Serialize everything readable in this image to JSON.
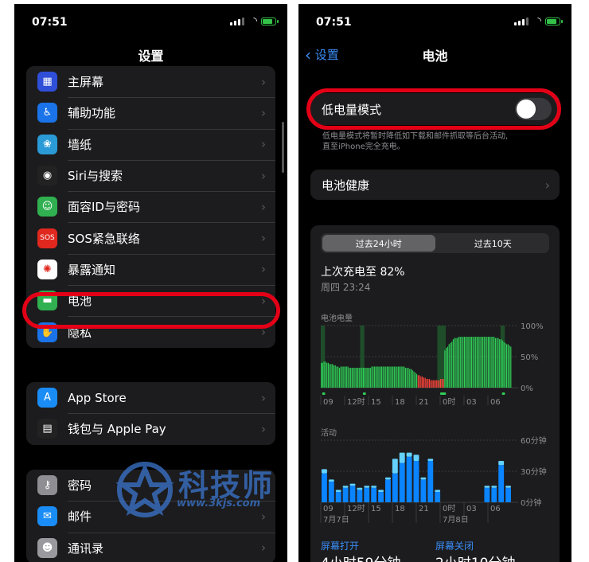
{
  "left": {
    "status_time": "07:51",
    "title": "设置",
    "group1": [
      {
        "label": "主屏幕",
        "icon": "home-screen-icon",
        "color": "#2f4fd8",
        "glyph": "▦"
      },
      {
        "label": "辅助功能",
        "icon": "accessibility-icon",
        "color": "#1a73e8",
        "glyph": "♿"
      },
      {
        "label": "墙纸",
        "icon": "wallpaper-icon",
        "color": "#2a9bd6",
        "glyph": "❀"
      },
      {
        "label": "Siri与搜索",
        "icon": "siri-icon",
        "color": "#222",
        "glyph": "◉"
      },
      {
        "label": "面容ID与密码",
        "icon": "face-id-icon",
        "color": "#30b050",
        "glyph": "☺"
      },
      {
        "label": "SOS紧急联络",
        "icon": "sos-icon",
        "color": "#e0281e",
        "glyph": "SOS"
      },
      {
        "label": "暴露通知",
        "icon": "exposure-icon",
        "color": "#fff",
        "glyph": "✺"
      },
      {
        "label": "电池",
        "icon": "battery-icon",
        "color": "#30b050",
        "glyph": "▬"
      },
      {
        "label": "隐私",
        "icon": "privacy-hand-icon",
        "color": "#1a73e8",
        "glyph": "✋"
      }
    ],
    "group2": [
      {
        "label": "App Store",
        "icon": "app-store-icon",
        "color": "#1a8cf5",
        "glyph": "A"
      },
      {
        "label": "钱包与 Apple Pay",
        "icon": "wallet-icon",
        "color": "#222",
        "glyph": "▤"
      }
    ],
    "group3": [
      {
        "label": "密码",
        "icon": "key-icon",
        "color": "#8e8e93",
        "glyph": "⚷"
      },
      {
        "label": "邮件",
        "icon": "mail-icon",
        "color": "#1a8cf5",
        "glyph": "✉"
      },
      {
        "label": "通讯录",
        "icon": "contacts-icon",
        "color": "#9a9a9e",
        "glyph": "☻"
      }
    ],
    "watermark_text": "科技师",
    "watermark_url": "www.3kjs.com"
  },
  "right": {
    "status_time": "07:51",
    "back_label": "设置",
    "title": "电池",
    "low_power_label": "低电量模式",
    "low_power_on": false,
    "footnote": "低电量模式将暂时降低如下载和邮件抓取等后台活动,\n直至iPhone完全充电。",
    "health_label": "电池健康",
    "seg_24h": "过去24小时",
    "seg_10d": "过去10天",
    "last_charge": "上次充电至 82%",
    "last_charge_time": "周四 23:24",
    "battery_level_label": "电池电量",
    "activity_label": "活动",
    "date1": "7月7日",
    "date2": "7月8日",
    "screen_on_label": "屏幕打开",
    "screen_on_value": "4小时59分钟",
    "screen_off_label": "屏幕关闭",
    "screen_off_value": "2小时10分钟"
  },
  "chart_data": [
    {
      "type": "bar",
      "title": "电池电量",
      "y_tick_labels": [
        "100%",
        "50%",
        "0%"
      ],
      "x_tick_labels": [
        "09",
        "12时",
        "15",
        "18",
        "21",
        "0时",
        "03",
        "06"
      ],
      "ylim": [
        0,
        100
      ],
      "values": [
        40,
        40,
        42,
        42,
        40,
        40,
        38,
        38,
        38,
        36,
        36,
        34,
        34,
        32,
        34,
        34,
        34,
        34,
        34,
        34,
        32,
        32,
        32,
        32,
        32,
        32,
        32,
        32,
        32,
        32,
        32,
        32,
        32,
        32,
        32,
        32,
        34,
        34,
        34,
        34,
        34,
        34,
        34,
        34,
        34,
        34,
        34,
        34,
        34,
        34,
        34,
        34,
        34,
        34,
        34,
        34,
        34,
        34,
        34,
        34,
        32,
        32,
        32,
        30,
        30,
        28,
        26,
        24,
        22,
        20,
        20,
        18,
        18,
        16,
        16,
        14,
        14,
        14,
        12,
        12,
        12,
        12,
        12,
        12,
        12,
        14,
        14,
        14,
        60,
        64,
        66,
        70,
        72,
        74,
        78,
        80,
        80,
        80,
        82,
        82,
        82,
        82,
        82,
        82,
        82,
        82,
        82,
        82,
        82,
        82,
        82,
        82,
        82,
        82,
        82,
        82,
        82,
        82,
        82,
        82,
        82,
        82,
        82,
        82,
        80,
        80,
        80,
        78,
        78,
        76,
        74,
        72,
        70,
        70,
        68,
        66
      ],
      "colors": {
        "normal": "#30d158",
        "low": "#ff453a",
        "charging_bg": "#1f4d2a"
      }
    },
    {
      "type": "bar",
      "title": "活动",
      "y_tick_labels": [
        "60分钟",
        "30分钟",
        "0分钟"
      ],
      "x_tick_labels": [
        "09",
        "12时",
        "15",
        "18",
        "21",
        "0时",
        "03",
        "06"
      ],
      "ylim": [
        0,
        60
      ],
      "x_dates": [
        "7月7日",
        "7月8日"
      ],
      "screen_on": [
        28,
        20,
        10,
        14,
        16,
        12,
        14,
        14,
        10,
        22,
        28,
        38,
        44,
        40,
        22,
        40,
        10,
        0,
        0,
        0,
        0,
        0,
        0,
        14,
        14,
        36,
        14
      ],
      "screen_off": [
        4,
        2,
        2,
        2,
        2,
        2,
        2,
        2,
        2,
        2,
        14,
        10,
        4,
        6,
        2,
        2,
        2,
        0,
        0,
        0,
        0,
        0,
        0,
        2,
        2,
        4,
        2
      ],
      "colors": {
        "screen_on": "#0a84ff",
        "screen_off": "#64d2ff"
      }
    }
  ]
}
